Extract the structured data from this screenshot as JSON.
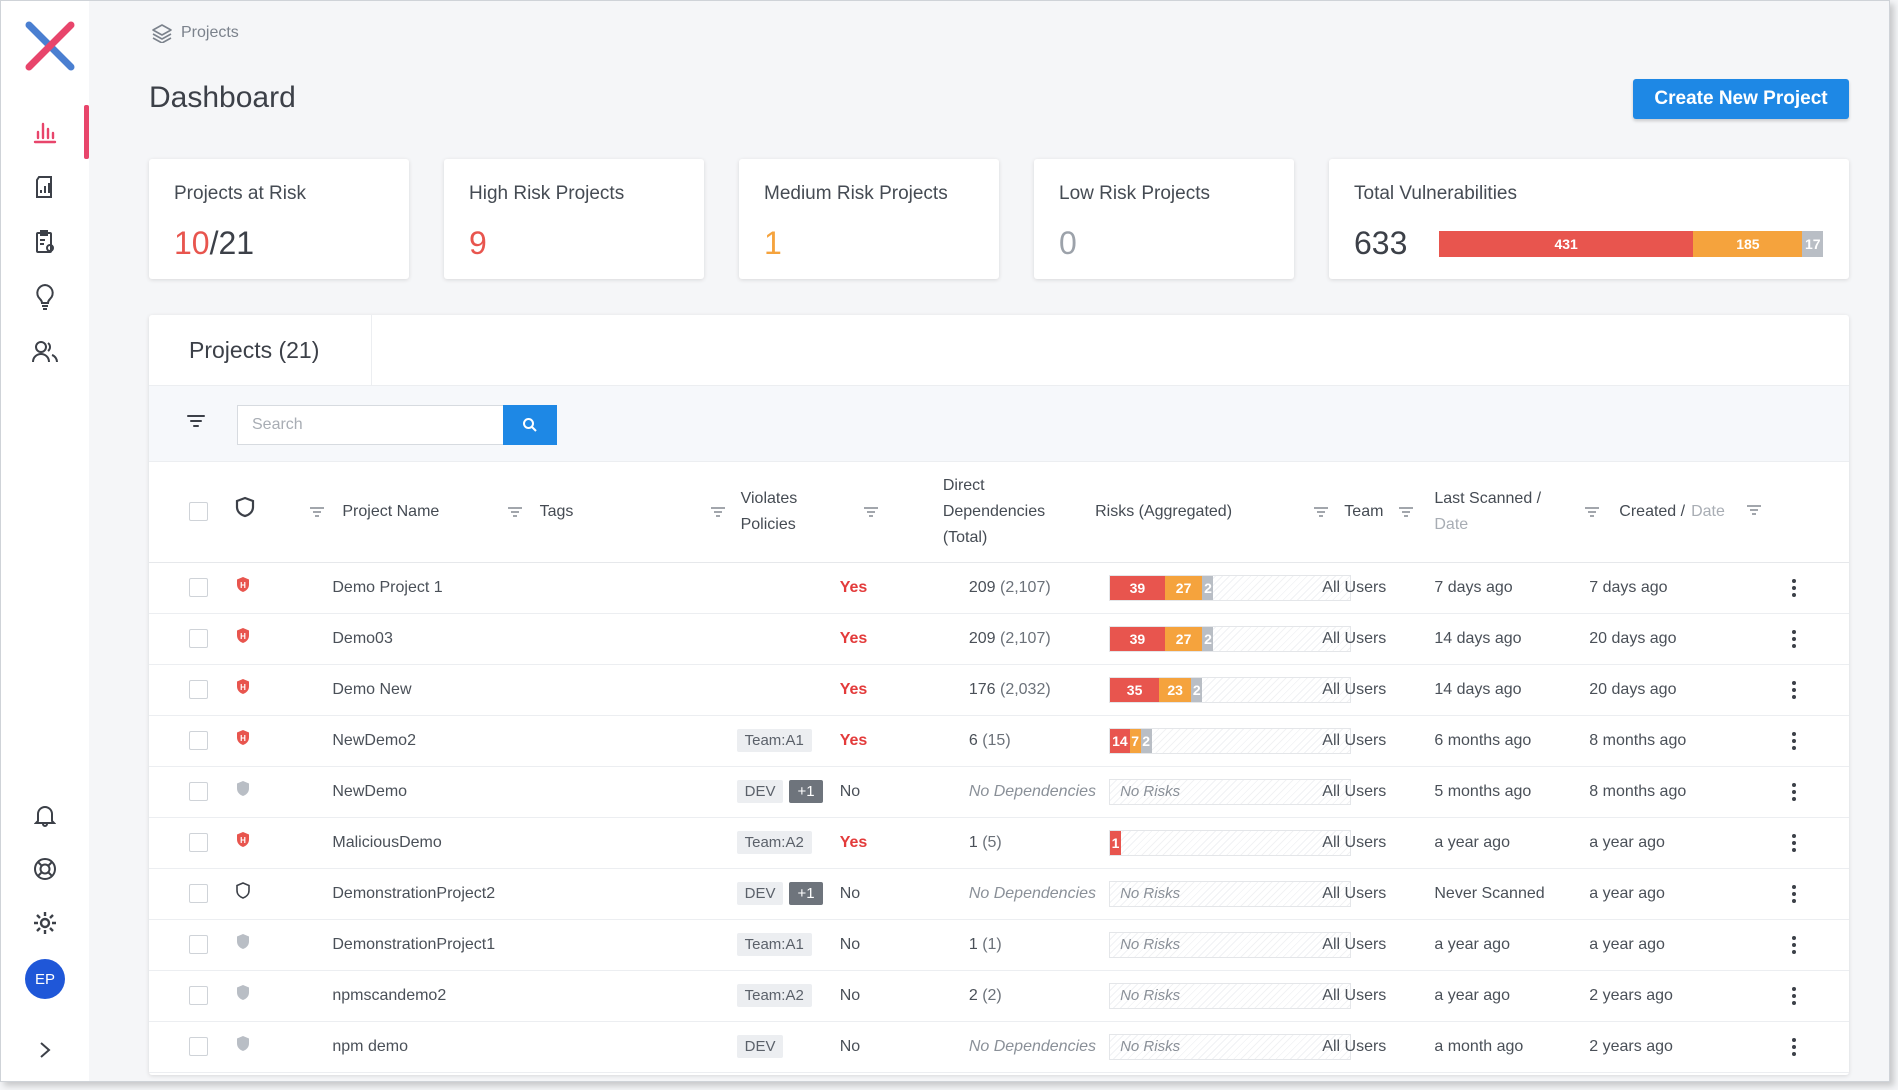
{
  "breadcrumb": "Projects",
  "page_title": "Dashboard",
  "create_button": "Create New Project",
  "user_initials": "EP",
  "cards": {
    "at_risk": {
      "title": "Projects at Risk",
      "risky": "10",
      "sep": "/",
      "total": "21"
    },
    "high": {
      "title": "High Risk Projects",
      "value": "9"
    },
    "medium": {
      "title": "Medium Risk Projects",
      "value": "1"
    },
    "low": {
      "title": "Low Risk Projects",
      "value": "0"
    },
    "vulns": {
      "title": "Total Vulnerabilities",
      "value": "633",
      "high": 431,
      "medium": 185,
      "low": 17
    }
  },
  "colors": {
    "accent": "#1e88e5",
    "high": "#e8554e",
    "medium": "#f5a33d",
    "low": "#b9bec5",
    "nav_active": "#e8456b"
  },
  "panel": {
    "tab": "Projects (21)",
    "search_placeholder": "Search",
    "columns": {
      "name": "Project Name",
      "tags": "Tags",
      "violates_1": "Violates",
      "violates_2": "Policies",
      "deps_1": "Direct",
      "deps_2": "Dependencies",
      "deps_3": "(Total)",
      "risks": "Risks (Aggregated)",
      "team": "Team",
      "scanned_1": "Last Scanned /",
      "scanned_2": "Date",
      "created_1": "Created /",
      "created_2": "Date"
    }
  },
  "rows": [
    {
      "name": "Demo Project 1",
      "shield": "high",
      "tags": [],
      "violates": "Yes",
      "deps": "209",
      "deps_total": "(2,107)",
      "risks": [
        39,
        27,
        2
      ],
      "team": "All Users",
      "scanned": "7 days ago",
      "created": "7 days ago"
    },
    {
      "name": "Demo03",
      "shield": "high",
      "tags": [],
      "violates": "Yes",
      "deps": "209",
      "deps_total": "(2,107)",
      "risks": [
        39,
        27,
        2
      ],
      "team": "All Users",
      "scanned": "14 days ago",
      "created": "20 days ago"
    },
    {
      "name": "Demo New",
      "shield": "high",
      "tags": [],
      "violates": "Yes",
      "deps": "176",
      "deps_total": "(2,032)",
      "risks": [
        35,
        23,
        2
      ],
      "team": "All Users",
      "scanned": "14 days ago",
      "created": "20 days ago"
    },
    {
      "name": "NewDemo2",
      "shield": "high",
      "tags": [
        "Team:A1"
      ],
      "violates": "Yes",
      "deps": "6",
      "deps_total": "(15)",
      "risks": [
        14,
        7,
        2
      ],
      "team": "All Users",
      "scanned": "6 months ago",
      "created": "8 months ago"
    },
    {
      "name": "NewDemo",
      "shield": "none",
      "tags": [
        "DEV",
        "+1"
      ],
      "violates": "No",
      "deps": "",
      "deps_total": "",
      "no_deps": "No Dependencies",
      "risks": [],
      "no_risks": "No Risks",
      "team": "All Users",
      "scanned": "5 months ago",
      "created": "8 months ago"
    },
    {
      "name": "MaliciousDemo",
      "shield": "high",
      "tags": [
        "Team:A2"
      ],
      "violates": "Yes",
      "deps": "1",
      "deps_total": "(5)",
      "risks": [
        1,
        0,
        0
      ],
      "team": "All Users",
      "scanned": "a year ago",
      "created": "a year ago"
    },
    {
      "name": "DemonstrationProject2",
      "shield": "outline",
      "tags": [
        "DEV",
        "+1"
      ],
      "violates": "No",
      "deps": "",
      "deps_total": "",
      "no_deps": "No Dependencies",
      "risks": [],
      "no_risks": "No Risks",
      "team": "All Users",
      "scanned": "Never Scanned",
      "created": "a year ago"
    },
    {
      "name": "DemonstrationProject1",
      "shield": "none",
      "tags": [
        "Team:A1"
      ],
      "violates": "No",
      "deps": "1",
      "deps_total": "(1)",
      "risks": [],
      "no_risks": "No Risks",
      "team": "All Users",
      "scanned": "a year ago",
      "created": "a year ago"
    },
    {
      "name": "npmscandemo2",
      "shield": "none",
      "tags": [
        "Team:A2"
      ],
      "violates": "No",
      "deps": "2",
      "deps_total": "(2)",
      "risks": [],
      "no_risks": "No Risks",
      "team": "All Users",
      "scanned": "a year ago",
      "created": "2 years ago"
    },
    {
      "name": "npm demo",
      "shield": "none",
      "tags": [
        "DEV"
      ],
      "violates": "No",
      "deps": "",
      "deps_total": "",
      "no_deps": "No Dependencies",
      "risks": [],
      "no_risks": "No Risks",
      "team": "All Users",
      "scanned": "a month ago",
      "created": "2 years ago"
    }
  ]
}
